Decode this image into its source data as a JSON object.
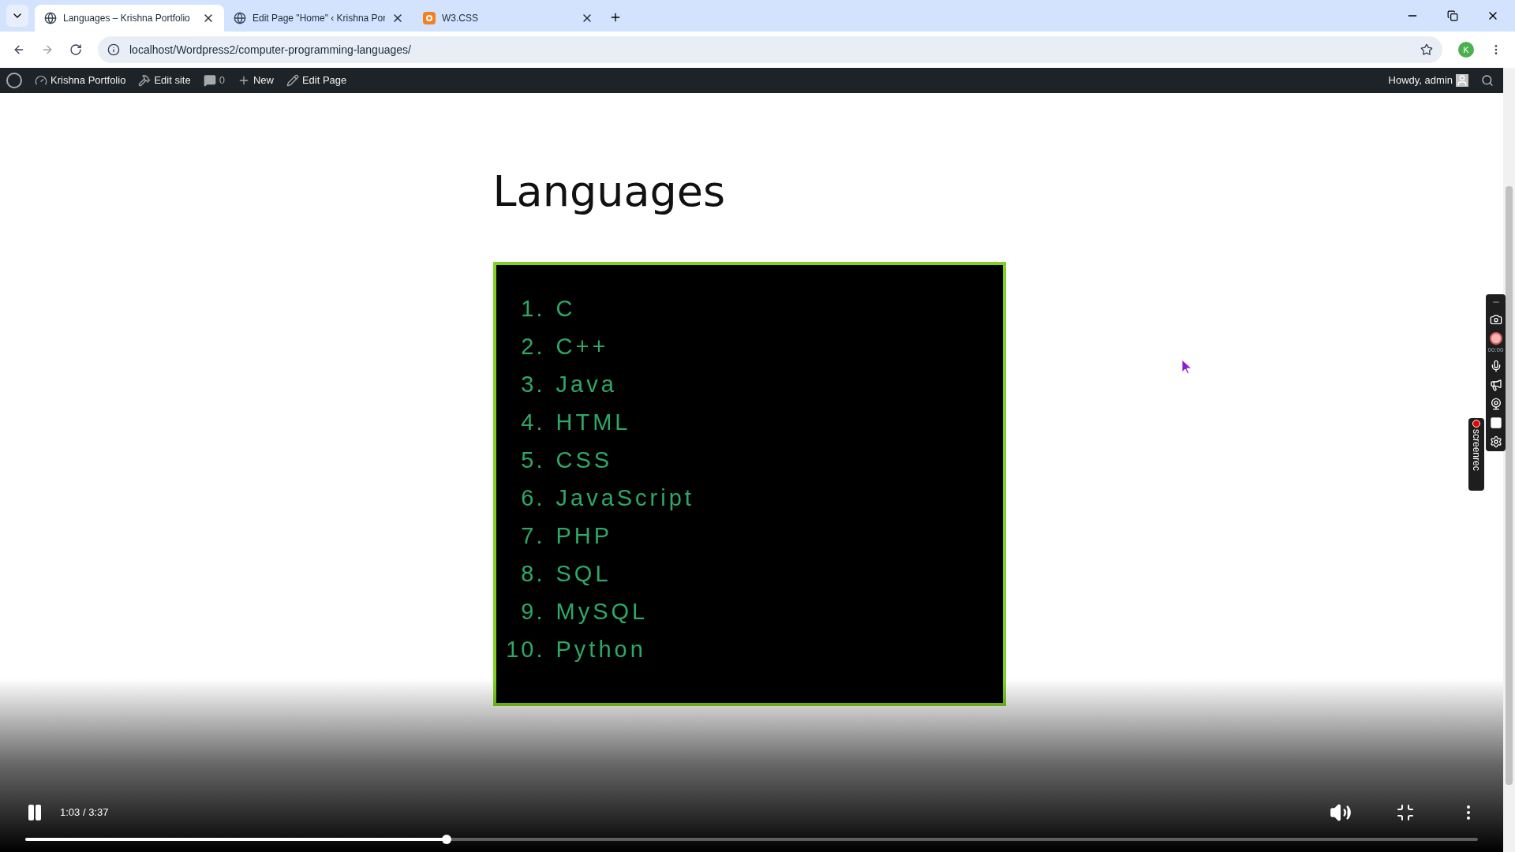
{
  "browser": {
    "tabs": [
      {
        "title": "Languages – Krishna Portfolio",
        "selected": true,
        "kind": "globe"
      },
      {
        "title": "Edit Page \"Home\" ‹ Krishna Por",
        "selected": false,
        "kind": "globe"
      },
      {
        "title": "W3.CSS",
        "selected": false,
        "kind": "app"
      }
    ],
    "address": "localhost/Wordpress2/computer-programming-languages/",
    "profile_initial": "K"
  },
  "admin_bar": {
    "site": "Krishna Portfolio",
    "edit_site": "Edit site",
    "comments": "0",
    "new": "New",
    "edit_page": "Edit Page",
    "greeting": "Howdy, admin"
  },
  "page": {
    "title": "Languages",
    "items": [
      {
        "number": "1.",
        "name": "C"
      },
      {
        "number": "2.",
        "name": "C++"
      },
      {
        "number": "3.",
        "name": "Java"
      },
      {
        "number": "4.",
        "name": "HTML"
      },
      {
        "number": "5.",
        "name": "CSS"
      },
      {
        "number": "6.",
        "name": "JavaScript"
      },
      {
        "number": "7.",
        "name": "PHP"
      },
      {
        "number": "8.",
        "name": "SQL"
      },
      {
        "number": "9.",
        "name": "MySQL"
      },
      {
        "number": "10.",
        "name": "Python"
      }
    ]
  },
  "recorder": {
    "timer": "00:00",
    "brand": "screenrec"
  },
  "player": {
    "playing": true,
    "time": "1:03 / 3:37",
    "level": 0.29
  }
}
